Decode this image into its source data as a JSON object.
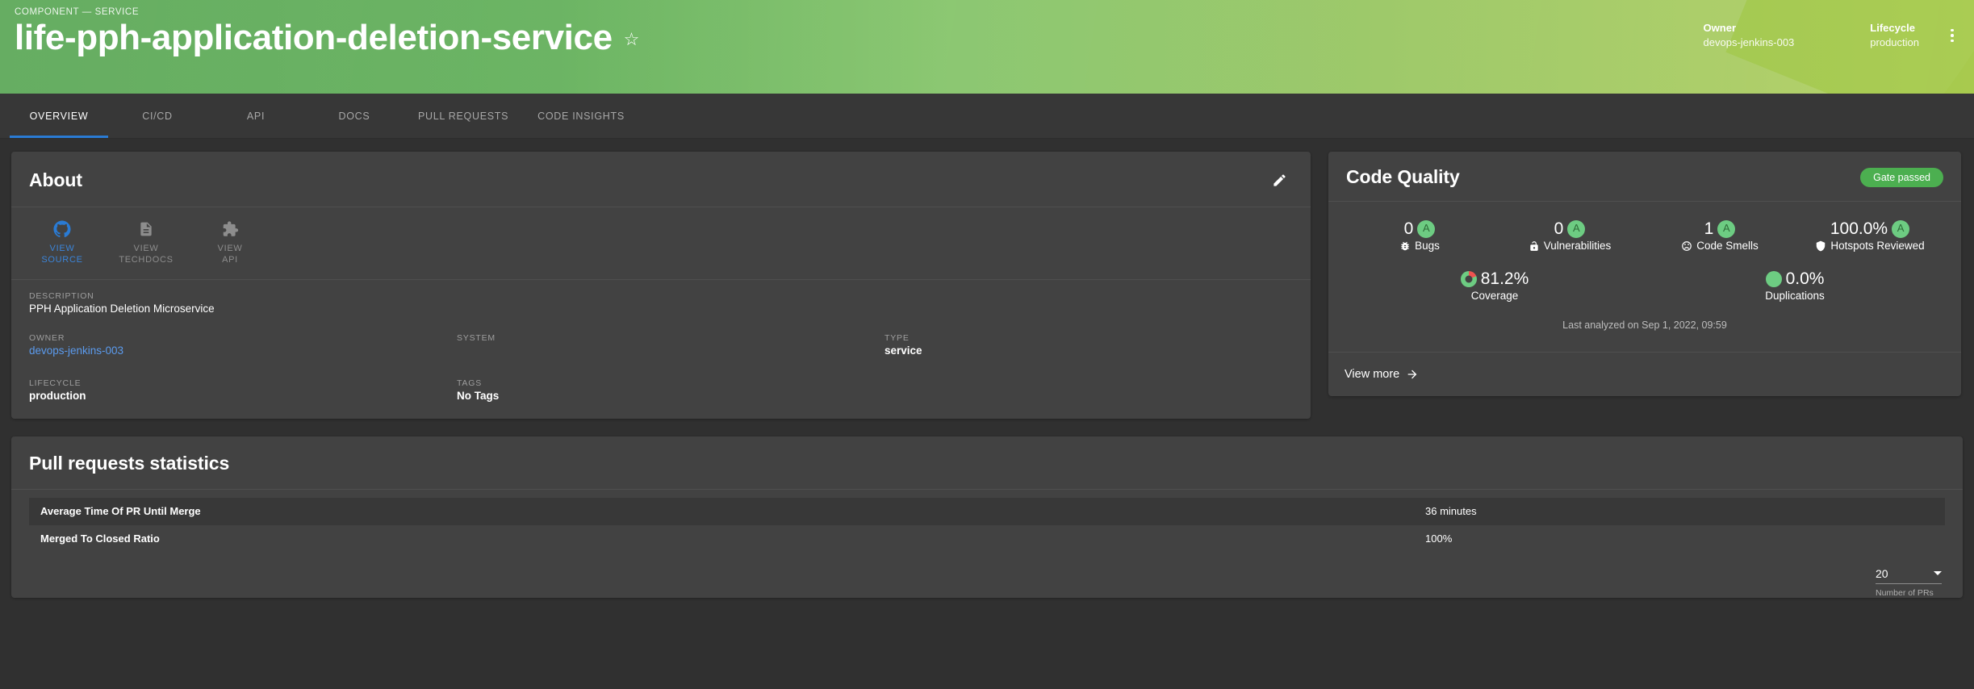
{
  "header": {
    "breadcrumb": "COMPONENT — SERVICE",
    "title": "life-pph-application-deletion-service",
    "star_icon": "star-outline-icon",
    "meta": [
      {
        "label": "Owner",
        "value": "devops-jenkins-003"
      },
      {
        "label": "Lifecycle",
        "value": "production"
      }
    ],
    "accent_green": "#4caf50",
    "accent_light_green": "#b3cf60"
  },
  "tabs": [
    {
      "label": "OVERVIEW",
      "active": true
    },
    {
      "label": "CI/CD",
      "active": false
    },
    {
      "label": "API",
      "active": false
    },
    {
      "label": "DOCS",
      "active": false
    },
    {
      "label": "PULL REQUESTS",
      "active": false
    },
    {
      "label": "CODE INSIGHTS",
      "active": false
    }
  ],
  "about": {
    "title": "About",
    "edit_icon": "pencil-icon",
    "links": [
      {
        "label": "VIEW\nSOURCE",
        "label_l1": "VIEW",
        "label_l2": "SOURCE",
        "icon": "github-icon",
        "enabled": true
      },
      {
        "label_l1": "VIEW",
        "label_l2": "TECHDOCS",
        "icon": "document-icon",
        "enabled": false
      },
      {
        "label_l1": "VIEW",
        "label_l2": "API",
        "icon": "puzzle-piece-icon",
        "enabled": false
      }
    ],
    "description_label": "DESCRIPTION",
    "description_value": "PPH Application Deletion Microservice",
    "fields": [
      {
        "label": "OWNER",
        "value": "devops-jenkins-003",
        "is_link": true
      },
      {
        "label": "SYSTEM",
        "value": "",
        "is_link": false
      },
      {
        "label": "TYPE",
        "value": "service",
        "is_link": false
      },
      {
        "label": "LIFECYCLE",
        "value": "production",
        "is_link": false
      },
      {
        "label": "TAGS",
        "value": "No Tags",
        "is_link": false
      },
      {
        "label": "",
        "value": "",
        "is_link": false
      }
    ]
  },
  "code_quality": {
    "title": "Code Quality",
    "gate_badge": "Gate passed",
    "gate_color": "#4caf50",
    "metrics_row1": [
      {
        "value": "0",
        "rating": "A",
        "caption": "Bugs",
        "icon": "bug-icon"
      },
      {
        "value": "0",
        "rating": "A",
        "caption": "Vulnerabilities",
        "icon": "lock-icon"
      },
      {
        "value": "1",
        "rating": "A",
        "caption": "Code Smells",
        "icon": "frowning-face-icon"
      },
      {
        "value": "100.0%",
        "rating": "A",
        "caption": "Hotspots Reviewed",
        "icon": "shield-icon"
      }
    ],
    "metrics_row2": [
      {
        "value": "81.2%",
        "caption": "Coverage",
        "icon": "coverage-donut-icon",
        "percent": 81.2
      },
      {
        "value": "0.0%",
        "caption": "Duplications",
        "icon": "duplications-dot-icon",
        "percent": 0.0
      }
    ],
    "last_analyzed": "Last analyzed on Sep 1, 2022, 09:59",
    "view_more": "View more",
    "view_more_icon": "arrow-right-icon"
  },
  "pull_requests": {
    "title": "Pull requests statistics",
    "rows": [
      {
        "name": "Average Time Of PR Until Merge",
        "value": "36 minutes"
      },
      {
        "name": "Merged To Closed Ratio",
        "value": "100%"
      }
    ],
    "select": {
      "value": "20",
      "help": "Number of PRs",
      "caret_icon": "chevron-down-icon"
    }
  }
}
